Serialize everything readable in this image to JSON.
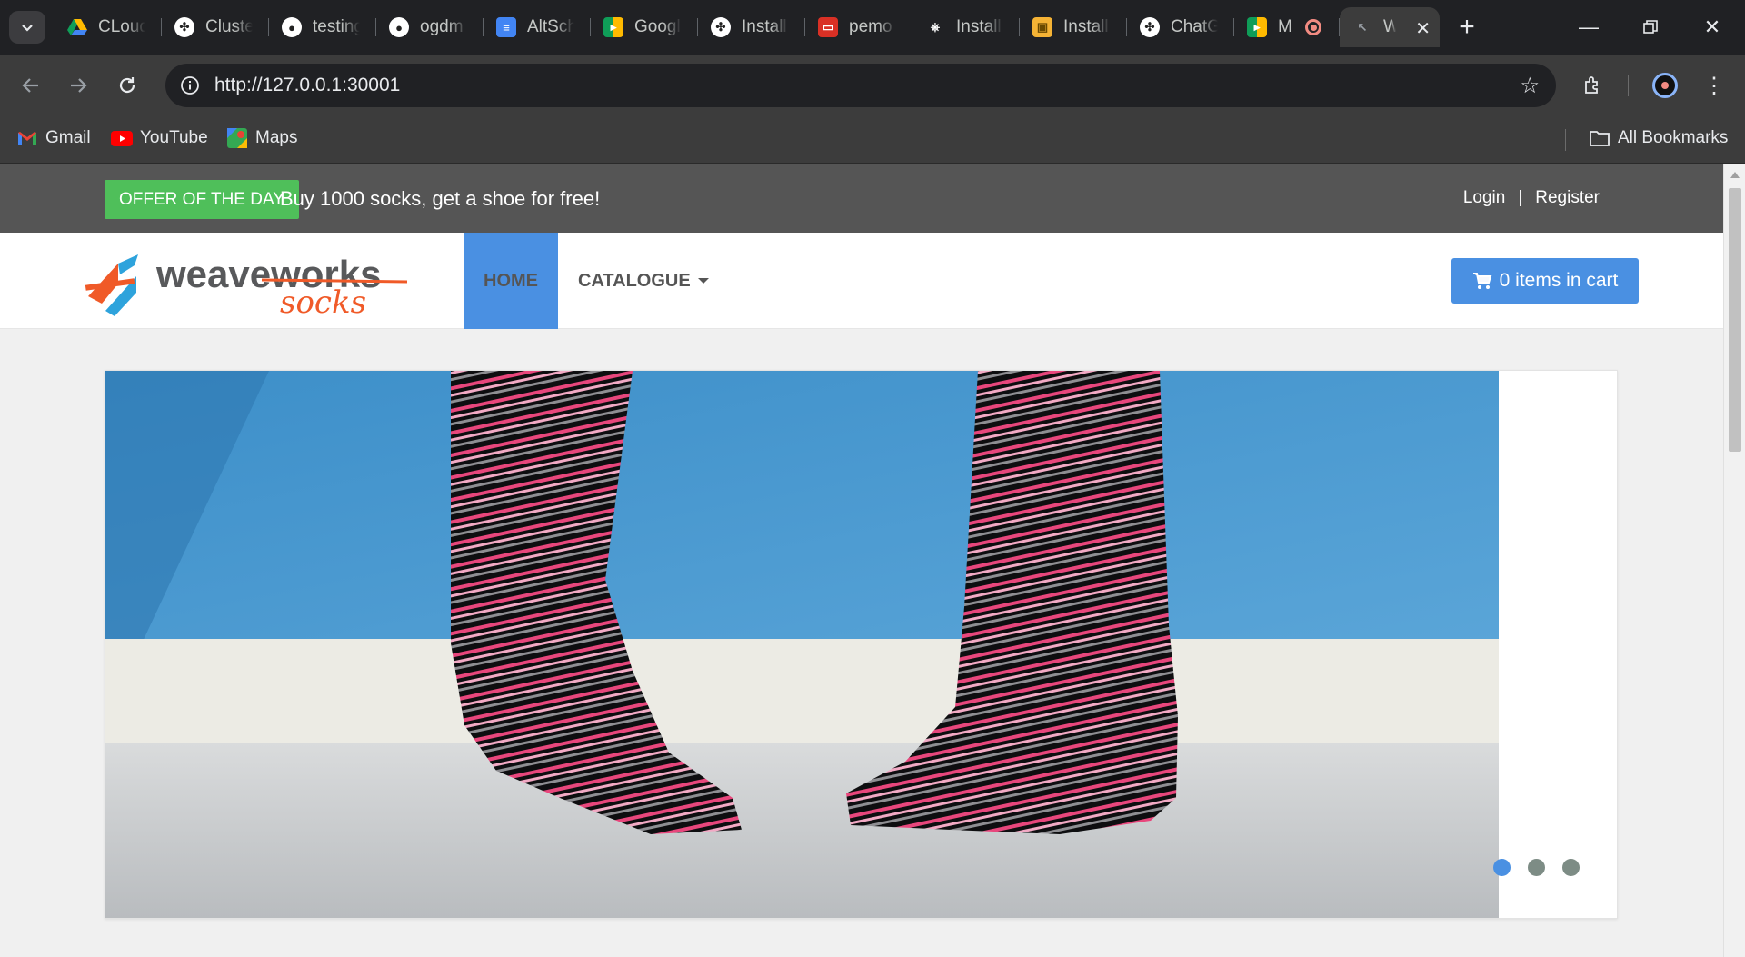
{
  "browser": {
    "tabs": [
      {
        "title": "CLoud",
        "icon": "google-drive-icon"
      },
      {
        "title": "Cluste",
        "icon": "chatgpt-icon"
      },
      {
        "title": "testing",
        "icon": "github-icon"
      },
      {
        "title": "ogdm",
        "icon": "github-icon"
      },
      {
        "title": "AltSch",
        "icon": "google-docs-icon"
      },
      {
        "title": "Googl",
        "icon": "google-meet-icon"
      },
      {
        "title": "Install",
        "icon": "chatgpt-icon"
      },
      {
        "title": "pemo",
        "icon": "slides-icon"
      },
      {
        "title": "Install",
        "icon": "helm-icon"
      },
      {
        "title": "Install",
        "icon": "package-icon"
      },
      {
        "title": "ChatG",
        "icon": "chatgpt-icon"
      },
      {
        "title": "M",
        "icon": "google-meet-icon"
      }
    ],
    "active_tab": {
      "title": "W",
      "icon": "weaveworks-icon"
    },
    "url": "http://127.0.0.1:30001",
    "bookmarks": [
      {
        "label": "Gmail",
        "icon": "gmail-icon"
      },
      {
        "label": "YouTube",
        "icon": "youtube-icon"
      },
      {
        "label": "Maps",
        "icon": "maps-icon"
      }
    ],
    "all_bookmarks_label": "All Bookmarks"
  },
  "page": {
    "offer_badge": "OFFER OF THE DAY",
    "offer_text": "Buy 1000 socks, get a shoe for free!",
    "login_label": "Login",
    "separator": "|",
    "register_label": "Register",
    "logo_text_top": "weaveworks",
    "logo_text_bottom": "socks",
    "nav_home": "HOME",
    "nav_catalogue": "CATALOGUE",
    "cart_label": "0 items in cart",
    "carousel": {
      "slides": 3,
      "active_slide": 1
    },
    "colors": {
      "accent": "#4a90e2",
      "offer": "#4fbf5a",
      "topbar": "#555555",
      "logo_orange": "#f05a28",
      "logo_blue": "#2ea3dc"
    }
  }
}
